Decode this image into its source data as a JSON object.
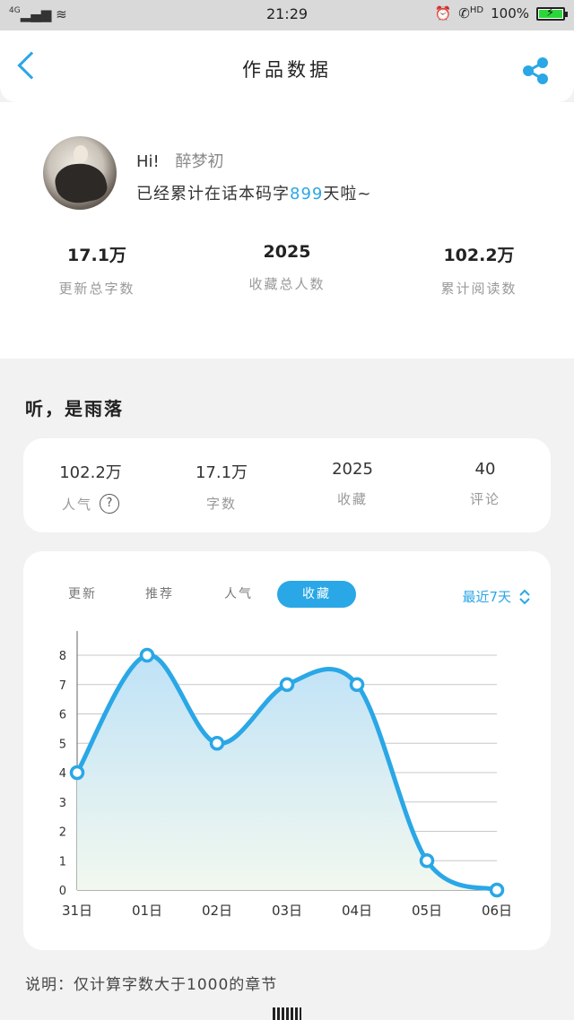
{
  "status_bar": {
    "network": "4G",
    "time": "21:29",
    "hd": "HD",
    "battery_percent": "100%",
    "battery_level": 1.0,
    "icons": [
      "signal-icon",
      "wifi-icon",
      "alarm-icon",
      "call-hd-icon",
      "battery-charging-icon"
    ]
  },
  "nav": {
    "title": "作品数据",
    "back_icon": "back-arrow-icon",
    "share_icon": "share-icon"
  },
  "profile": {
    "greeting": "Hi!",
    "name": "醉梦初",
    "days_prefix": "已经累计在话本码字",
    "days_value": "899",
    "days_suffix": "天啦~",
    "stats": [
      {
        "value": "17.1万",
        "label": "更新总字数"
      },
      {
        "value": "2025",
        "label": "收藏总人数"
      },
      {
        "value": "102.2万",
        "label": "累计阅读数"
      }
    ]
  },
  "work": {
    "title": "听，是雨落",
    "summary": [
      {
        "value": "102.2万",
        "label": "人气"
      },
      {
        "value": "17.1万",
        "label": "字数"
      },
      {
        "value": "2025",
        "label": "收藏"
      },
      {
        "value": "40",
        "label": "评论"
      }
    ],
    "help_glyph": "?"
  },
  "chart_tabs": {
    "tabs": [
      "更新",
      "推荐",
      "人气",
      "收藏"
    ],
    "active_index": 3,
    "range_label": "最近7天"
  },
  "chart_data": {
    "type": "area",
    "categories": [
      "31日",
      "01日",
      "02日",
      "03日",
      "04日",
      "05日",
      "06日"
    ],
    "values": [
      4,
      8,
      5,
      7,
      7,
      1,
      0
    ],
    "ylim": [
      0,
      8
    ],
    "yticks": [
      "0",
      "1",
      "2",
      "3",
      "4",
      "5",
      "6",
      "7",
      "8"
    ],
    "grid": true,
    "line_color": "#2aa7e6",
    "fill_top_color": "#bfe2f7",
    "fill_bottom_color": "#f2f8ef"
  },
  "footer": {
    "note": "说明：仅计算字数大于1000的章节"
  }
}
